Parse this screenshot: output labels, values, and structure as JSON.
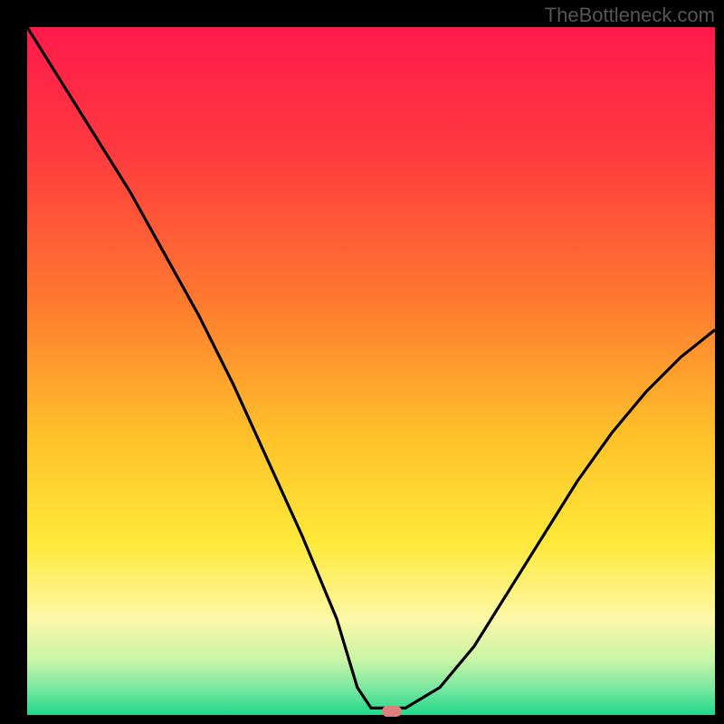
{
  "watermark": "TheBottleneck.com",
  "chart_data": {
    "type": "line",
    "title": "",
    "xlabel": "",
    "ylabel": "",
    "xlim": [
      0,
      100
    ],
    "ylim": [
      0,
      100
    ],
    "series": [
      {
        "name": "curve",
        "x": [
          0,
          5,
          10,
          15,
          20,
          25,
          30,
          35,
          40,
          45,
          48,
          50,
          53,
          55,
          60,
          65,
          70,
          75,
          80,
          85,
          90,
          95,
          100
        ],
        "y": [
          100,
          92,
          84,
          76,
          67,
          58,
          48,
          37,
          26,
          14,
          4,
          1,
          1,
          1,
          4,
          10,
          18,
          26,
          34,
          41,
          47,
          52,
          56
        ]
      }
    ],
    "gradient_stops": [
      {
        "pct": 0,
        "color": "#ff1a4b"
      },
      {
        "pct": 18,
        "color": "#ff3a3f"
      },
      {
        "pct": 40,
        "color": "#ff7a2f"
      },
      {
        "pct": 60,
        "color": "#ffc32a"
      },
      {
        "pct": 75,
        "color": "#ffe93a"
      },
      {
        "pct": 86,
        "color": "#fdf8a8"
      },
      {
        "pct": 92,
        "color": "#c9f5a6"
      },
      {
        "pct": 96,
        "color": "#7de8a0"
      },
      {
        "pct": 100,
        "color": "#1fd98a"
      }
    ],
    "marker": {
      "x": 53,
      "y": 0.5,
      "color": "#de7f7b"
    }
  }
}
